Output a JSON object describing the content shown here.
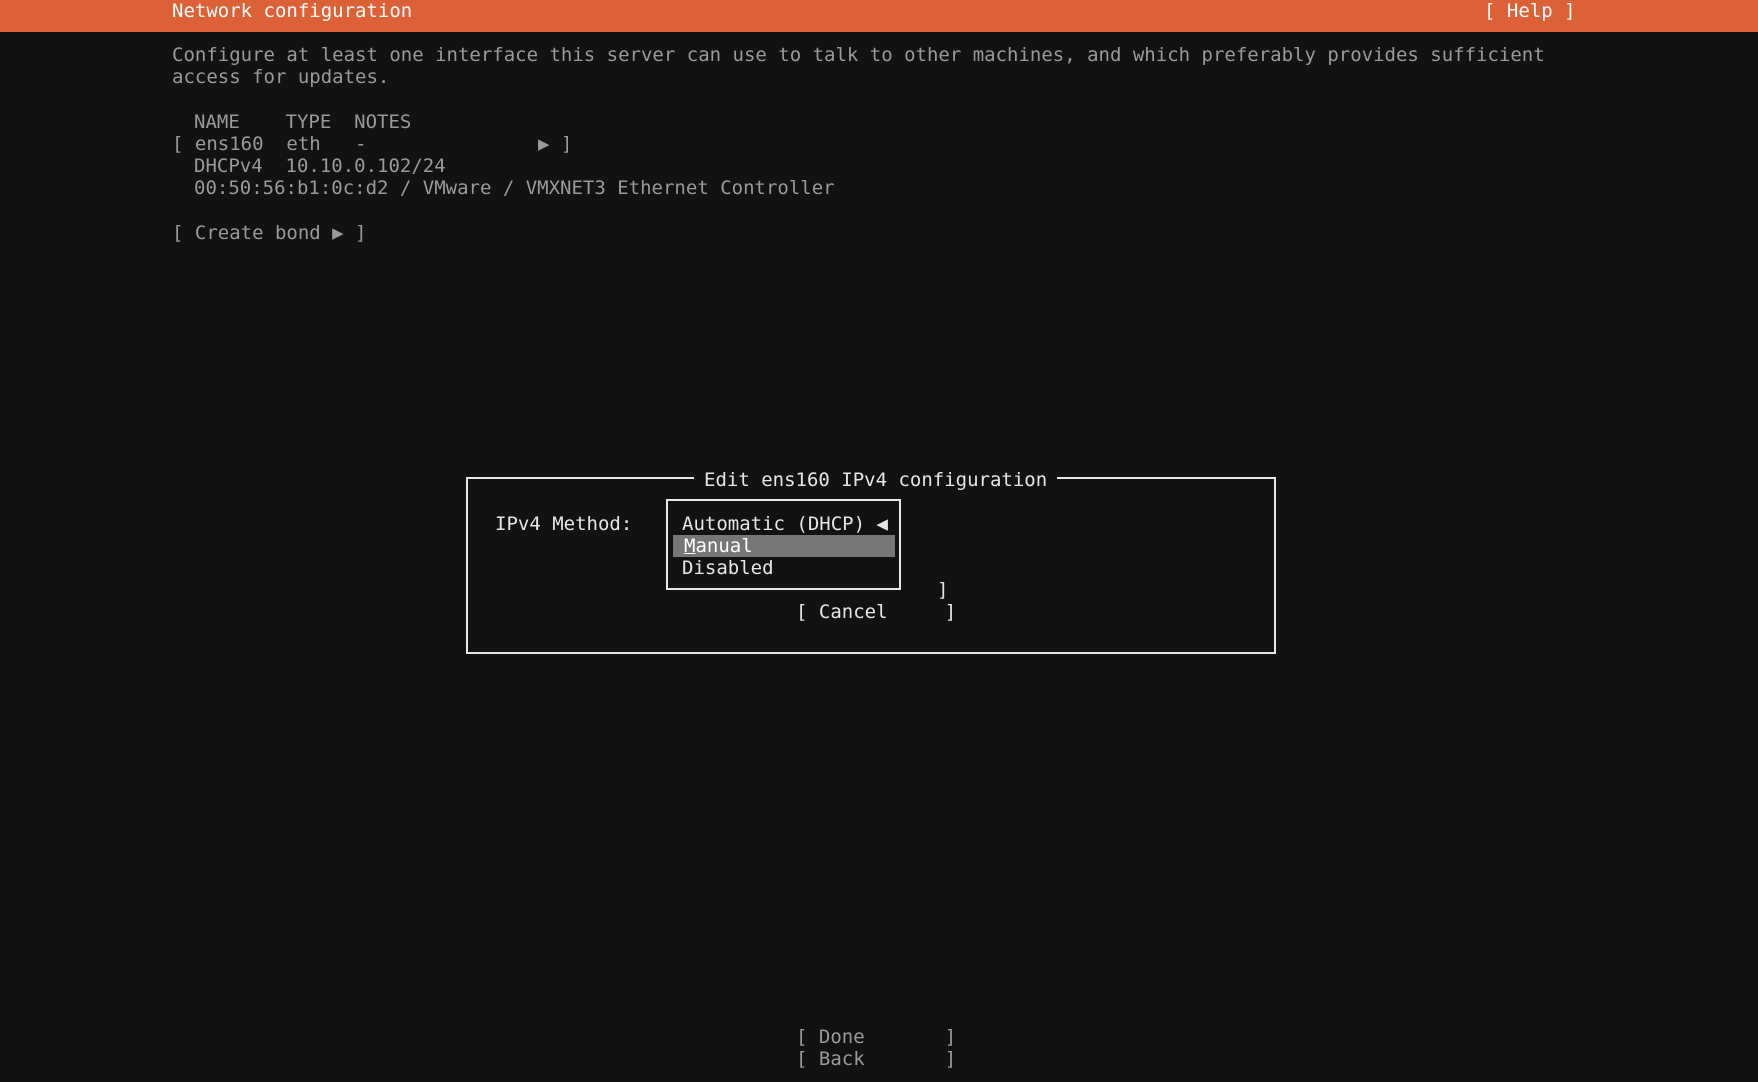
{
  "header": {
    "title": "Network configuration",
    "help_button": "[ Help ]"
  },
  "intro": "Configure at least one interface this server can use to talk to other machines, and which preferably provides sufficient access for updates.",
  "table": {
    "columns": [
      "NAME",
      "TYPE",
      "NOTES"
    ],
    "columns_line": "NAME    TYPE  NOTES",
    "interface": {
      "row": "[ ens160  eth   -               ▶ ]",
      "dhcp_line": "DHCPv4  10.10.0.102/24",
      "hw_line": "00:50:56:b1:0c:d2 / VMware / VMXNET3 Ethernet Controller"
    }
  },
  "create_bond": "[ Create bond ▶ ]",
  "dialog": {
    "title": "Edit ens160 IPv4 configuration",
    "method_label": "IPv4 Method:",
    "options": [
      {
        "label": "Automatic (DHCP) ◀",
        "selected": false
      },
      {
        "label_first": "M",
        "label_rest": "anual",
        "selected": true
      },
      {
        "label": "Disabled",
        "selected": false
      }
    ],
    "save_bracket": "]",
    "cancel_button": "[ Cancel     ]"
  },
  "footer": {
    "done_button": "[ Done       ]",
    "back_button": "[ Back       ]"
  },
  "colors": {
    "header_bg": "#dd6137",
    "background": "#121212",
    "selection": "#777777"
  }
}
